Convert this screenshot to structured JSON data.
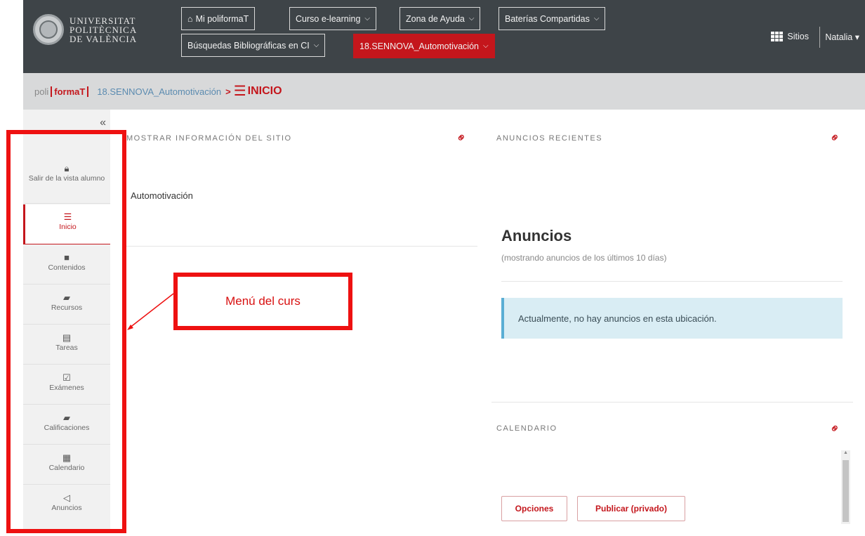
{
  "header": {
    "logo_lines": [
      "UNIVERSITAT",
      "POLITÈCNICA",
      "DE VALÈNCIA"
    ],
    "nav": [
      {
        "label": "Mi poliformaT",
        "icon": "home-icon",
        "dropdown": false
      },
      {
        "label": "Curso e-learning",
        "dropdown": true
      },
      {
        "label": "Zona de Ayuda",
        "dropdown": true
      },
      {
        "label": "Baterías Compartidas",
        "dropdown": true
      },
      {
        "label": "Búsquedas Bibliográficas en CI",
        "dropdown": true
      },
      {
        "label": "18.SENNOVA_Automotivación",
        "dropdown": true,
        "active": true
      }
    ],
    "sites_label": "Sitios",
    "user_label": "Natalia"
  },
  "breadcrumb": {
    "brand_poli": "poli",
    "brand_formaT": "formaT",
    "site": "18.SENNOVA_Automotivación",
    "separator": ">",
    "current": "INICIO"
  },
  "sidebar": {
    "collapse_label": "«",
    "items": [
      {
        "label": "Salir de la vista alumno",
        "icon": "lock-icon"
      },
      {
        "label": "Inicio",
        "icon": "list-icon",
        "active": true
      },
      {
        "label": "Contenidos",
        "icon": "folder-icon"
      },
      {
        "label": "Recursos",
        "icon": "folder-open-icon"
      },
      {
        "label": "Tareas",
        "icon": "file-icon"
      },
      {
        "label": "Exámenes",
        "icon": "check-square-icon"
      },
      {
        "label": "Calificaciones",
        "icon": "book-icon"
      },
      {
        "label": "Calendario",
        "icon": "calendar-icon"
      },
      {
        "label": "Anuncios",
        "icon": "bullhorn-icon"
      }
    ]
  },
  "site_info": {
    "title": "MOSTRAR INFORMACIÓN DEL SITIO",
    "site_name": "Automotivación"
  },
  "announcements": {
    "title": "ANUNCIOS RECIENTES",
    "heading": "Anuncios",
    "subheading": "(mostrando anuncios de los últimos 10 días)",
    "empty_message": "Actualmente, no hay anuncios en esta ubicación."
  },
  "calendar": {
    "title": "CALENDARIO",
    "options_button": "Opciones",
    "publish_button": "Publicar (privado)"
  },
  "overlay": {
    "label": "Menú del curs",
    "color": "#ee1111"
  },
  "colors": {
    "header_bg": "#3e4448",
    "accent": "#c4161c",
    "breadcrumb_bg": "#d8d9da",
    "sidebar_bg": "#f1f1f1"
  }
}
